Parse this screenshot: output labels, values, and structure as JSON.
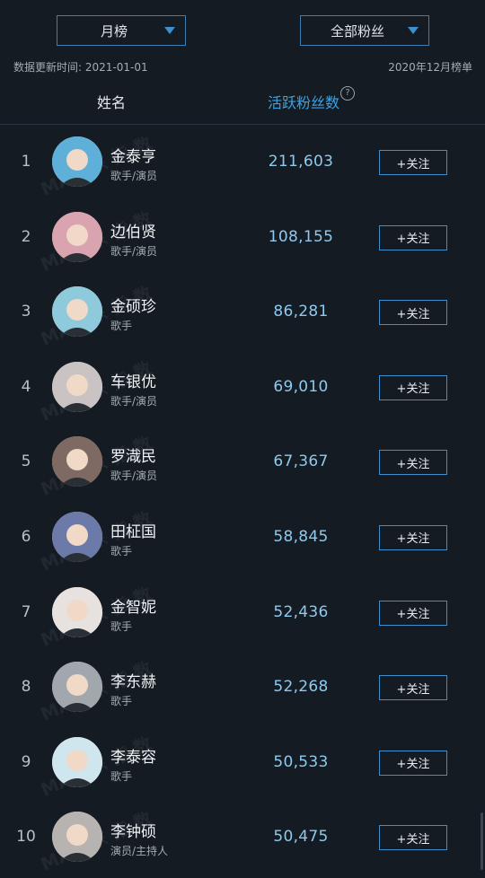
{
  "filters": {
    "period": "月榜",
    "fans_type": "全部粉丝"
  },
  "meta": {
    "updated": "数据更新时间: 2021-01-01",
    "board": "2020年12月榜单"
  },
  "columns": {
    "name": "姓名",
    "fans": "活跃粉丝数",
    "help": "?"
  },
  "watermark": "MAN 东 指 数",
  "follow_label": "+关注",
  "rows": [
    {
      "rank": "1",
      "name": "金泰亨",
      "role": "歌手/演员",
      "count": "211,603",
      "avatar_color": "#5fb0d8"
    },
    {
      "rank": "2",
      "name": "边伯贤",
      "role": "歌手/演员",
      "count": "108,155",
      "avatar_color": "#d9a3b0"
    },
    {
      "rank": "3",
      "name": "金硕珍",
      "role": "歌手",
      "count": "86,281",
      "avatar_color": "#8fc9dc"
    },
    {
      "rank": "4",
      "name": "车银优",
      "role": "歌手/演员",
      "count": "69,010",
      "avatar_color": "#c9c3c4"
    },
    {
      "rank": "5",
      "name": "罗渽民",
      "role": "歌手/演员",
      "count": "67,367",
      "avatar_color": "#7e6a63"
    },
    {
      "rank": "6",
      "name": "田柾国",
      "role": "歌手",
      "count": "58,845",
      "avatar_color": "#6b7aa8"
    },
    {
      "rank": "7",
      "name": "金智妮",
      "role": "歌手",
      "count": "52,436",
      "avatar_color": "#e7e2df"
    },
    {
      "rank": "8",
      "name": "李东赫",
      "role": "歌手",
      "count": "52,268",
      "avatar_color": "#a2a7ad"
    },
    {
      "rank": "9",
      "name": "李泰容",
      "role": "歌手",
      "count": "50,533",
      "avatar_color": "#cfe6ee"
    },
    {
      "rank": "10",
      "name": "李钟硕",
      "role": "演员/主持人",
      "count": "50,475",
      "avatar_color": "#b7b3b1"
    }
  ]
}
